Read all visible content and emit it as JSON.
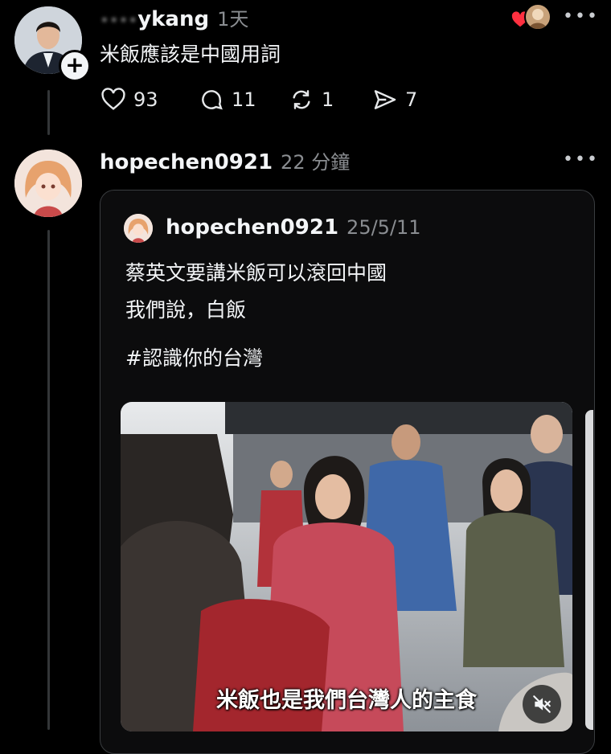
{
  "post1": {
    "username_blurred": "••••",
    "username": "ykang",
    "time": "1天",
    "text": "米飯應該是中國用詞",
    "follow_symbol": "+",
    "more": "•••",
    "actions": {
      "likes": "93",
      "replies": "11",
      "reposts": "1",
      "shares": "7"
    }
  },
  "post2": {
    "username": "hopechen0921",
    "time": "22 分鐘",
    "more": "•••"
  },
  "quote": {
    "username": "hopechen0921",
    "date": "25/5/11",
    "line1": "蔡英文要講米飯可以滾回中國",
    "line2": "我們說，白飯",
    "hashtag": "#認識你的台灣",
    "video": {
      "subtitle": "米飯也是我們台灣人的主食",
      "muted_icon": "speaker-muted-icon"
    }
  },
  "colors": {
    "background": "#000000",
    "heart": "#ff3040",
    "muted_text": "#8a8d91"
  }
}
